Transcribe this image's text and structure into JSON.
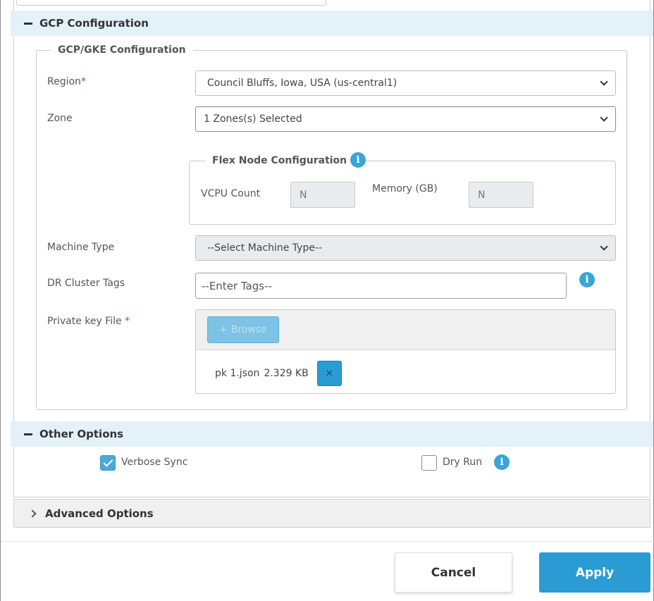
{
  "gcp_section": {
    "title": "GCP Configuration"
  },
  "gke_group": {
    "legend": "GCP/GKE Configuration",
    "region": {
      "label": "Region",
      "value": "Council Bluffs, Iowa, USA (us-central1)"
    },
    "zone": {
      "label": "Zone",
      "value": "1 Zones(s) Selected"
    },
    "flex": {
      "legend": "Flex Node Configuration",
      "vcpu_label": "VCPU Count",
      "vcpu_placeholder": "N",
      "memory_label": "Memory (GB)",
      "memory_placeholder": "N"
    },
    "machine_type": {
      "label": "Machine Type",
      "value": "--Select Machine Type--"
    },
    "dr_tags": {
      "label": "DR Cluster Tags",
      "placeholder": "--Enter Tags--"
    },
    "private_key": {
      "label": "Private key File",
      "browse_label": "+ Browse",
      "file_name": "pk 1.json",
      "file_size": "2.329 KB",
      "remove_glyph": "✕"
    }
  },
  "other_section": {
    "title": "Other Options",
    "verbose_sync": {
      "label": "Verbose Sync",
      "checked": true
    },
    "dry_run": {
      "label": "Dry Run",
      "checked": false
    }
  },
  "advanced_section": {
    "title": "Advanced Options"
  },
  "footer": {
    "cancel_label": "Cancel",
    "apply_label": "Apply"
  },
  "colors": {
    "accent": "#2a9bd3",
    "section_bg": "#e3f1f8",
    "required": "#d9302c"
  },
  "icons": {
    "info": "info-icon",
    "collapse": "minus-icon",
    "expand": "chevron-right-icon",
    "dropdown": "chevron-down-icon",
    "check": "check-icon"
  }
}
